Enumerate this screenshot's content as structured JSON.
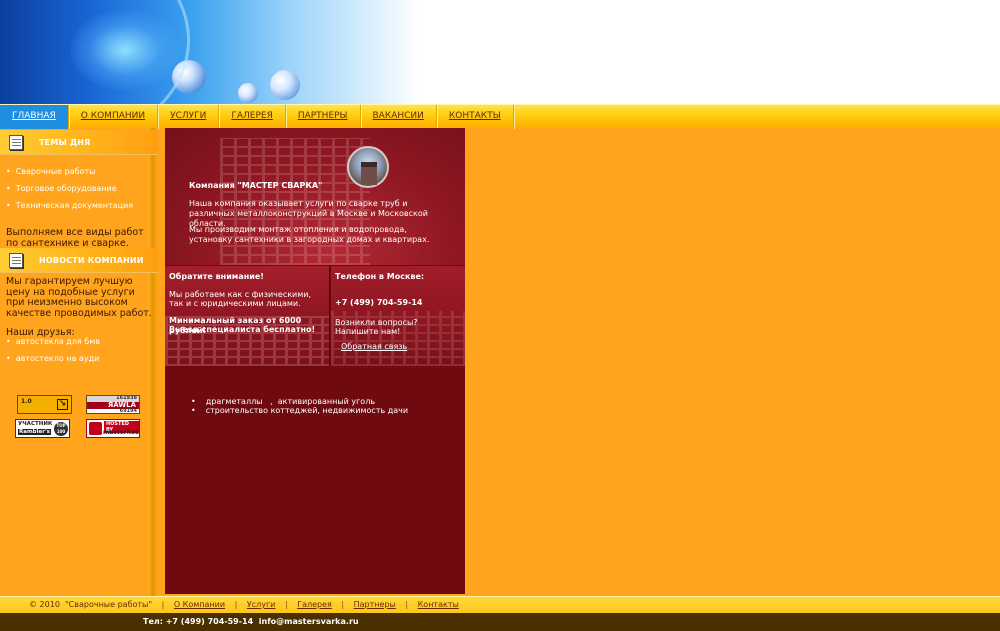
{
  "nav": {
    "items": [
      "ГЛАВНАЯ",
      "О КОМПАНИИ",
      "УСЛУГИ",
      "ГАЛЕРЕЯ",
      "ПАРТНЕРЫ",
      "ВАКАНСИИ",
      "КОНТАКТЫ"
    ]
  },
  "left": {
    "topics_title": "ТЕМЫ ДНЯ",
    "topics": [
      "Сварочные работы",
      "Торговое оборудование",
      "Техническая документация"
    ],
    "topics_note": "Выполняем все виды работ по сантехнике и сварке.",
    "news_title": "НОВОСТИ КОМПАНИИ",
    "news_text": "Мы гарантируем лучшую цену на подобные услуги при неизменно высоком качестве проводимых работ.",
    "friends_title": "Наши друзья:",
    "friends": [
      "автостекла для бмв",
      "автостекло на ауди"
    ],
    "badges": {
      "counter1": "1.0",
      "yawla_top": "161938",
      "yawla_name": "ЯAWLA",
      "yawla_bottom": "69194",
      "rambler_line1": "УЧАСТНИК",
      "rambler_line2": "Rambler's",
      "rambler_top": "TOP 100",
      "masterhost_line1": "HOSTED BY",
      "masterhost_line2": "masterhost"
    }
  },
  "main": {
    "intro_title": "Компания \"МАСТЕР СВАРКА\"",
    "intro_p1": "Наша компания оказывает услуги по сварке труб и различных металлоконструкций в Москве и Московской области.",
    "intro_p2": "Мы производим монтаж отопления и водопровода, установку сантехники в загородных домах и квартирах.",
    "notice_title": "Обратите внимание!",
    "notice_text1": "Мы работаем как с физическими,",
    "notice_text2": "так и с юридическими лицами.",
    "notice_bold1": "Минимальный заказ от 6000 рублей!",
    "notice_bold2": "Выезд специалиста бесплатно!",
    "phone_title": "Телефон в Москве:",
    "phone": "+7 (499) 704-59-14",
    "question1": "Возникли вопросы?",
    "question2": "Напишите нам!",
    "callback": "Обратная связь",
    "tags": [
      "драгметаллы   ,  активированный уголь",
      "строительство коттеджей, недвижимость дачи"
    ]
  },
  "footer": {
    "copyright": "© 2010  \"Сварочные работы\"",
    "links": [
      "О Компании",
      "Услуги",
      "Галерея",
      "Партнеры",
      "Контакты"
    ],
    "contacts": "Тел: +7 (499) 704-59-14  info@mastersvarka.ru"
  },
  "colors": {
    "background": "#ffa41c",
    "main_panel": "#6f0b10",
    "nav_active": "#1f8de0",
    "bottom_bar": "#4a3000"
  }
}
